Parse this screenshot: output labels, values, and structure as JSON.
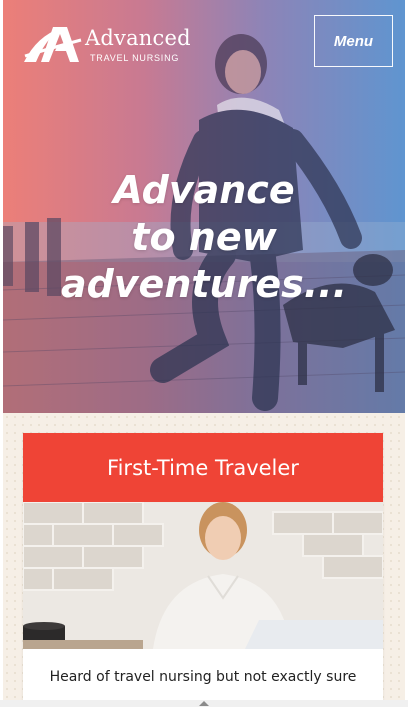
{
  "header": {
    "logo": {
      "word": "Advanced",
      "sub": "TRAVEL NURSING"
    },
    "menu_label": "Menu"
  },
  "hero": {
    "headline_lines": [
      "Advance",
      "to new",
      "adventures..."
    ]
  },
  "card": {
    "title": "First-Time Traveler",
    "text": "Heard of travel nursing but not exactly sure"
  },
  "colors": {
    "hero_gradient_left": "#ec7f78",
    "hero_gradient_right": "#5f95d0",
    "card_header": "#ef4436",
    "content_background": "#f6efe6"
  }
}
